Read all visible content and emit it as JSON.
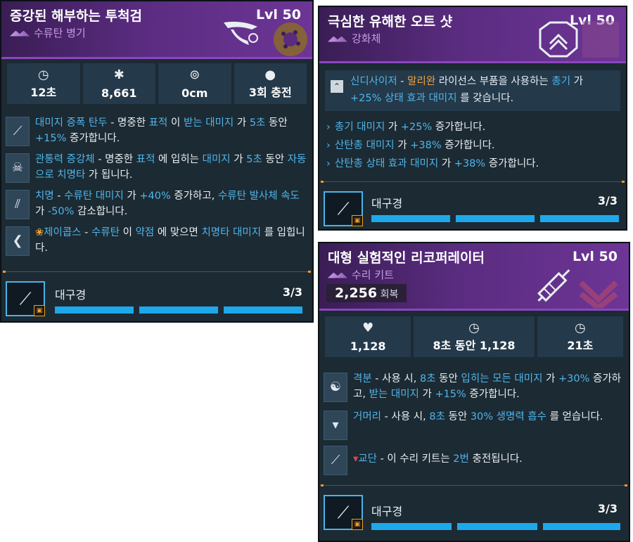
{
  "card1": {
    "title": "증강된 해부하는 투척검",
    "level": "Lvl 50",
    "subtitle": "수류탄 병기",
    "stats": [
      {
        "icon": "stopwatch-icon",
        "value": "12초"
      },
      {
        "icon": "bug-damage-icon",
        "value": "8,661"
      },
      {
        "icon": "radius-icon",
        "value": "0cm"
      },
      {
        "icon": "grenade-icon",
        "value": "3회 충전"
      }
    ],
    "perks": [
      {
        "icon": "blade-icon",
        "name": "대미지 증폭 탄두",
        "t1": " - 명중한 ",
        "k1": "표적",
        "t2": " 이 ",
        "k2": "받는 대미지",
        "t3": " 가 ",
        "k3": "5초",
        "t4": " 동안 ",
        "k4": "+15%",
        "t5": " 증가합니다."
      },
      {
        "icon": "skull-icon",
        "name": "관통력 증강체",
        "t1": " - 명중한 ",
        "k1": "표적",
        "t2": " 에 입히는 ",
        "k2": "대미지",
        "t3": " 가 ",
        "k3": "5초",
        "t4": " 동안 ",
        "k4": "자동으로 치명타",
        "t5": " 가 됩니다."
      },
      {
        "icon": "twin-blades-icon",
        "name": "치명",
        "t1": " - ",
        "k1": "수류탄 대미지",
        "t2": " 가 ",
        "k2": "+40%",
        "t3": " 증가하고, ",
        "k3": "수류탄 발사체 속도",
        "t4": " 가 ",
        "k4": "-50%",
        "t5": " 감소합니다."
      },
      {
        "icon": "boomerang-icon",
        "name": "제이콥스",
        "t1": " - ",
        "k1": "수류탄",
        "t2": " 이 ",
        "k2": "약점",
        "t3": " 에 맞으면 ",
        "k3": "치명타 대미지",
        "t4": " 를 입힙니다.",
        "k4": "",
        "t5": ""
      }
    ],
    "category": "대구경",
    "count": "3/3"
  },
  "card2": {
    "title": "극심한 유해한 오트 샷",
    "level": "Lvl 50",
    "subtitle": "강화체",
    "synergy": {
      "a": "신디사이저",
      "b": " - ",
      "c": "말리완",
      "d": " 라이선스 부품을 사용하는 ",
      "e": "총기",
      "f": " 가 ",
      "g": "+25% 상태 효과 대미지",
      "h": " 를 갖습니다."
    },
    "bullets": [
      {
        "k": "총기 대미지",
        "t": " 가 ",
        "v": "+25%",
        "e": " 증가합니다."
      },
      {
        "k": "산탄총 대미지",
        "t": " 가 ",
        "v": "+38%",
        "e": " 증가합니다."
      },
      {
        "k": "산탄총 상태 효과 대미지",
        "t": " 가 ",
        "v": "+38%",
        "e": " 증가합니다."
      }
    ],
    "category": "대구경",
    "count": "3/3"
  },
  "card3": {
    "title": "대형 실험적인 리코퍼레이터",
    "level": "Lvl 50",
    "subtitle": "수리 키트",
    "heal_value": "2,256",
    "heal_label": "회복",
    "stats": [
      {
        "icon": "heart-icon",
        "value": "1,128"
      },
      {
        "icon": "timer-heal-icon",
        "value": "8초 동안 1,128"
      },
      {
        "icon": "stopwatch-icon",
        "value": "21초"
      }
    ],
    "perks": [
      {
        "icon": "yin-yang-icon",
        "name": "격분",
        "t1": " - 사용 시, ",
        "k1": "8초",
        "t2": " 동안 ",
        "k2": "입히는 모든 대미지",
        "t3": " 가 ",
        "k3": "+30%",
        "t4": " 증가하고, ",
        "k4": "받는 대미지",
        "t5": " 가 ",
        "k5": "+15%",
        "t6": " 증가합니다."
      },
      {
        "icon": "fangs-icon",
        "name": "거머리",
        "t1": " - 사용 시, ",
        "k1": "8초",
        "t2": " 동안 ",
        "k2": "30% 생명력 흡수",
        "t3": " 를 얻습니다.",
        "k3": "",
        "t4": "",
        "k4": "",
        "t5": "",
        "k5": "",
        "t6": ""
      },
      {
        "icon": "syringes-icon",
        "name": "교단",
        "t1": " - 이 수리 키트는 ",
        "k1": "2번",
        "t2": " 충전됩니다.",
        "k2": "",
        "t3": "",
        "k3": "",
        "t4": "",
        "k4": "",
        "t5": "",
        "k5": "",
        "t6": ""
      }
    ],
    "category": "대구경",
    "count": "3/3"
  }
}
